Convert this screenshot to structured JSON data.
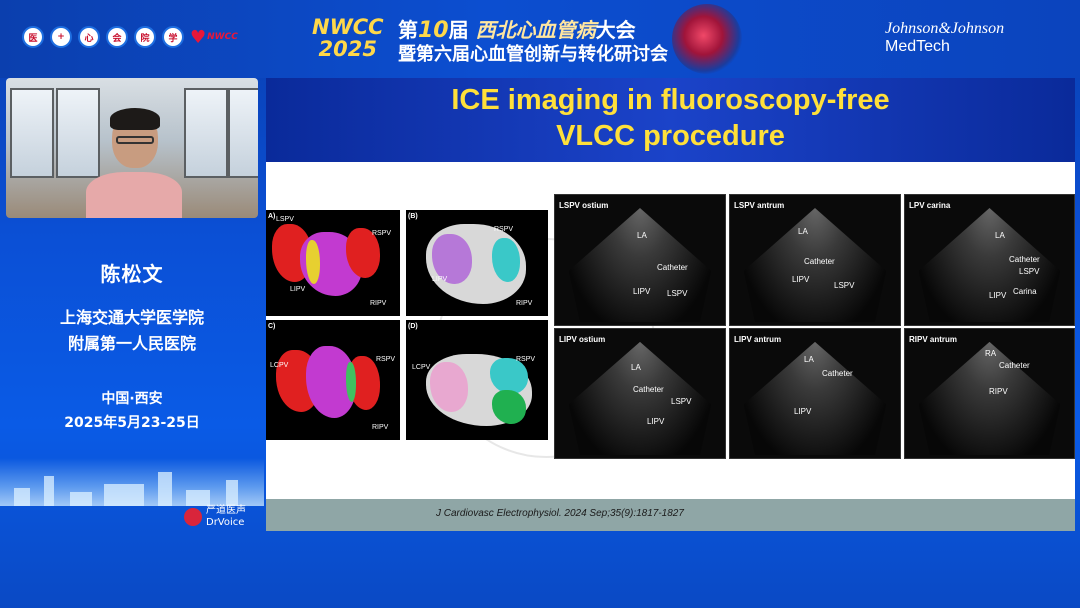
{
  "header": {
    "logos": [
      "医",
      "+",
      "心",
      "会",
      "院",
      "学"
    ],
    "heart_logo": "NWCC",
    "nwcc_line1": "NWCC",
    "nwcc_line2": "2025",
    "title_prefix": "第",
    "title_big": "10",
    "title_mid": "届",
    "title_art": "西北心血管病",
    "title_suffix": "大会",
    "subtitle": "暨第六届心血管创新与转化研讨会",
    "sponsor_line1": "Johnson&Johnson",
    "sponsor_line2": "MedTech"
  },
  "speaker": {
    "name": "陈松文",
    "affiliation_line1": "上海交通大学医学院",
    "affiliation_line2": "附属第一人民医院",
    "location": "中国·西安",
    "date": "2025年5月23-25日"
  },
  "branding": {
    "line1": "严道医声",
    "line2": "DrVoice"
  },
  "slide": {
    "title_line1": "ICE imaging in fluoroscopy-free",
    "title_line2": "VLCC procedure",
    "citation": "J Cardiovasc Electrophysiol. 2024 Sep;35(9):1817-1827",
    "maps": [
      {
        "label": "A)",
        "tags": [
          "LSPV",
          "RSPV",
          "LIPV",
          "RIPV"
        ]
      },
      {
        "label": "(B)",
        "tags": [
          "RSPV",
          "LIPV",
          "RIPV"
        ]
      },
      {
        "label": "C)",
        "tags": [
          "LCPV",
          "RSPV",
          "RIPV"
        ]
      },
      {
        "label": "(D)",
        "tags": [
          "LCPV",
          "RSPV"
        ]
      }
    ],
    "ultrasound": [
      {
        "title": "LSPV ostium",
        "labels": [
          "LA",
          "Catheter",
          "LIPV",
          "LSPV"
        ]
      },
      {
        "title": "LSPV antrum",
        "labels": [
          "LA",
          "Catheter",
          "LIPV",
          "LSPV"
        ]
      },
      {
        "title": "LPV carina",
        "labels": [
          "LA",
          "Catheter",
          "LSPV",
          "LIPV",
          "Carina"
        ]
      },
      {
        "title": "LIPV ostium",
        "labels": [
          "LA",
          "Catheter",
          "LSPV",
          "LIPV"
        ]
      },
      {
        "title": "LIPV antrum",
        "labels": [
          "LA",
          "Catheter",
          "LIPV"
        ]
      },
      {
        "title": "RIPV antrum",
        "labels": [
          "RA",
          "Catheter",
          "RIPV"
        ]
      }
    ]
  },
  "colors": {
    "gold": "#ffd84a",
    "slide_title": "#ffe03a",
    "brand_red": "#d9253b"
  }
}
